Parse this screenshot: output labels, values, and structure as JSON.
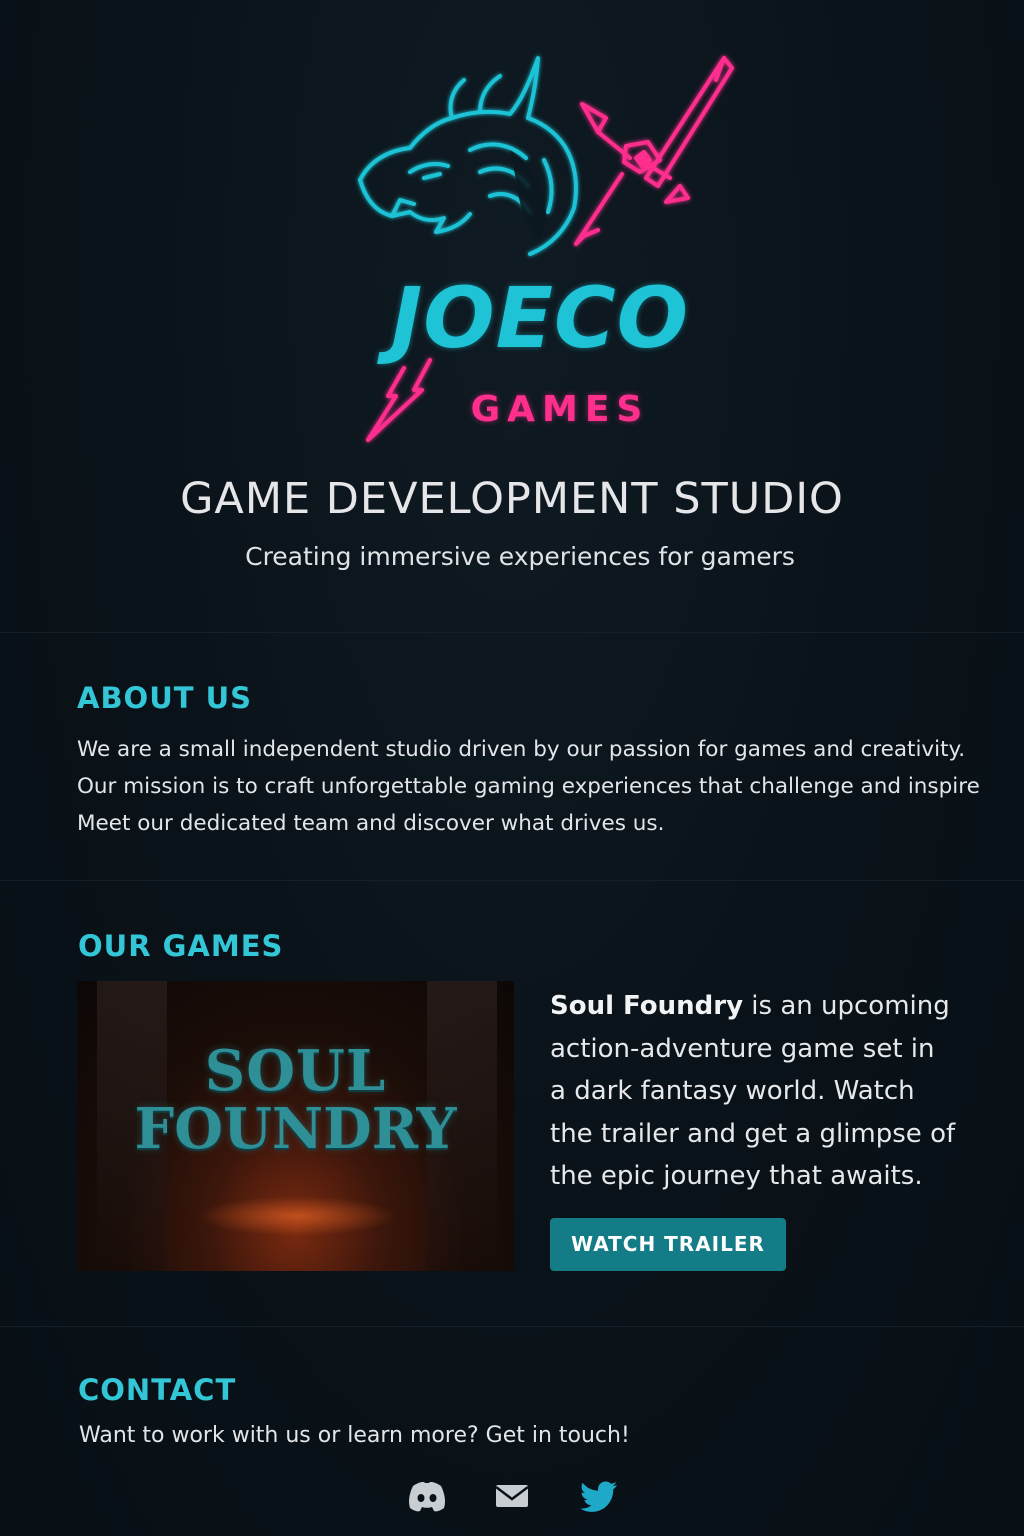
{
  "brand": {
    "logo_main": "JOECO",
    "logo_sub": "GAMES",
    "colors": {
      "cyan": "#1ec3d6",
      "pink": "#ff2f8e",
      "accent": "#33c6d6",
      "button": "#137c86",
      "background": "#0a1219"
    }
  },
  "hero": {
    "title": "GAME DEVELOPMENT STUDIO",
    "subtitle": "Creating immersive experiences for gamers"
  },
  "about": {
    "heading": "ABOUT US",
    "lines": [
      "We are a small independent studio driven by our passion for games and creativity.",
      "Our mission is to craft unforgettable gaming experiences that challenge and inspire",
      "Meet our dedicated team and discover what drives us."
    ]
  },
  "games": {
    "heading": "OUR GAMES",
    "featured": {
      "art_title_line1": "SOUL",
      "art_title_line2": "FOUNDRY",
      "name": "Soul Foundry",
      "desc_line1_rest": " is an upcoming",
      "desc_lines": [
        "action-adventure game set in",
        "a dark fantasy world. Watch",
        "the trailer and get a glimpse of",
        "the epic journey that awaits."
      ],
      "button_label": "WATCH TRAILER"
    }
  },
  "contact": {
    "heading": "CONTACT",
    "text": "Want to work with us or learn more? Get in touch!",
    "socials": [
      {
        "icon": "discord-icon",
        "color": "#c9ced3"
      },
      {
        "icon": "mail-icon",
        "color": "#c9ced3"
      },
      {
        "icon": "twitter-icon",
        "color": "#1ea9c9"
      }
    ]
  }
}
